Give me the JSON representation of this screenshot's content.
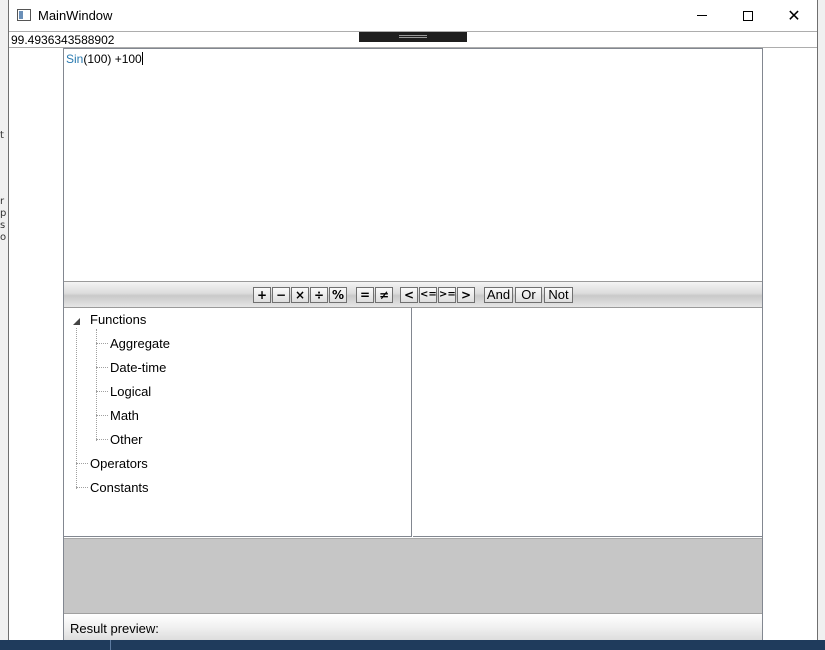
{
  "window": {
    "title": "MainWindow"
  },
  "result": {
    "value": "99.4936343588902"
  },
  "editor": {
    "expression_function": "Sin",
    "expression_rest": "(100) +100"
  },
  "toolbar": {
    "buttons": [
      "+",
      "−",
      "×",
      "÷",
      "%",
      "=",
      "≠",
      "<",
      "<=",
      ">=",
      ">",
      "And",
      "Or",
      "Not"
    ]
  },
  "tree": {
    "functions": "Functions",
    "aggregate": "Aggregate",
    "datetime": "Date-time",
    "logical": "Logical",
    "math": "Math",
    "other": "Other",
    "operators": "Operators",
    "constants": "Constants"
  },
  "status": {
    "label": "Result preview:"
  }
}
